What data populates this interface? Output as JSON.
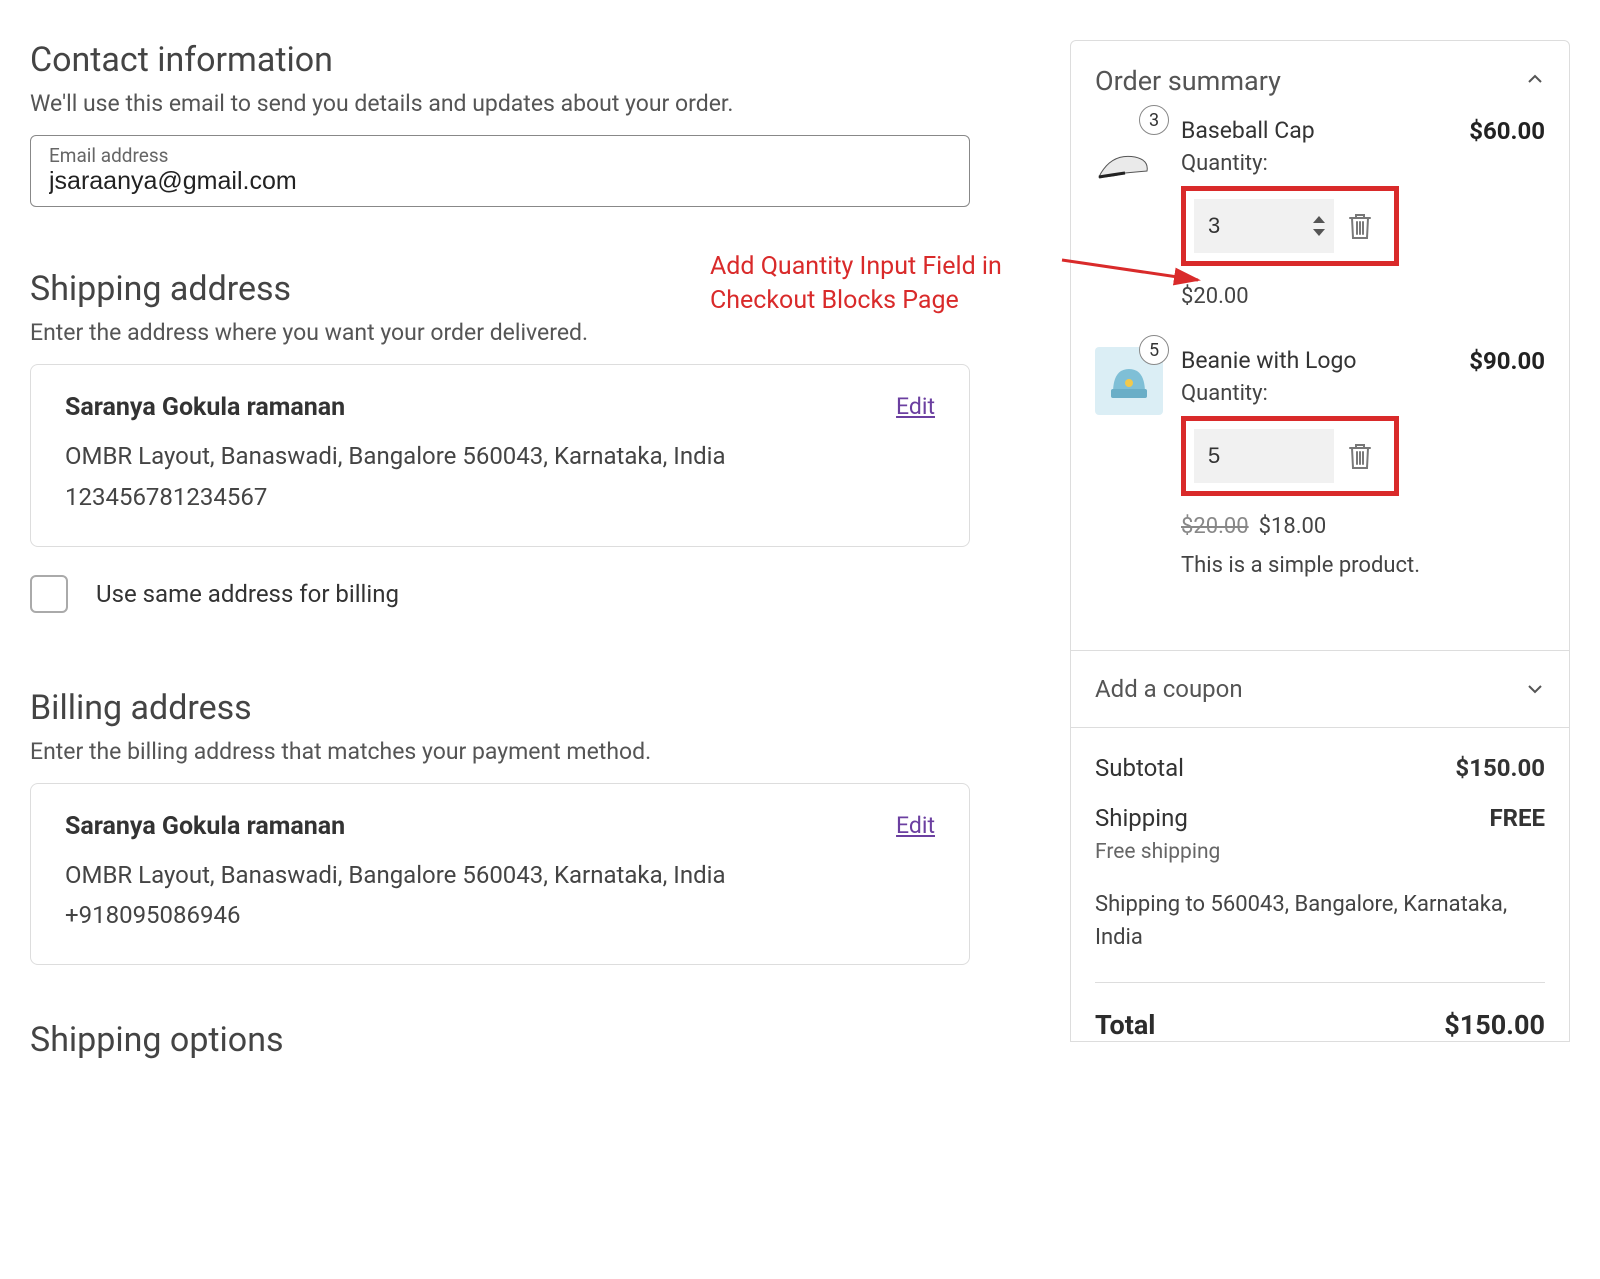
{
  "contact": {
    "title": "Contact information",
    "desc": "We'll use this email to send you details and updates about your order.",
    "email_label": "Email address",
    "email_value": "jsaraanya@gmail.com"
  },
  "shipping": {
    "title": "Shipping address",
    "desc": "Enter the address where you want your order delivered.",
    "name": "Saranya Gokula ramanan",
    "edit": "Edit",
    "address": "OMBR Layout, Banaswadi, Bangalore 560043, Karnataka, India",
    "extra": "123456781234567",
    "same_billing_label": "Use same address for billing"
  },
  "billing": {
    "title": "Billing address",
    "desc": "Enter the billing address that matches your payment method.",
    "name": "Saranya Gokula ramanan",
    "edit": "Edit",
    "address": "OMBR Layout, Banaswadi, Bangalore 560043, Karnataka, India",
    "phone": "+918095086946"
  },
  "shipping_options": {
    "title": "Shipping options"
  },
  "annotation": {
    "line1": "Add Quantity Input Field in",
    "line2": "Checkout Blocks Page"
  },
  "summary": {
    "title": "Order summary",
    "items": [
      {
        "badge": "3",
        "name": "Baseball Cap",
        "line_total": "$60.00",
        "qty_label": "Quantity:",
        "qty_value": "3",
        "unit_price": "$20.00",
        "show_stepper": true
      },
      {
        "badge": "5",
        "name": "Beanie with Logo",
        "line_total": "$90.00",
        "qty_label": "Quantity:",
        "qty_value": "5",
        "unit_original": "$20.00",
        "unit_price": "$18.00",
        "desc": "This is a simple product.",
        "show_stepper": false
      }
    ],
    "coupon_label": "Add a coupon",
    "subtotal_label": "Subtotal",
    "subtotal_value": "$150.00",
    "shipping_label": "Shipping",
    "shipping_value": "FREE",
    "shipping_method": "Free shipping",
    "shipping_to": "Shipping to 560043, Bangalore, Karnataka, India",
    "total_label": "Total",
    "total_value": "$150.00"
  }
}
